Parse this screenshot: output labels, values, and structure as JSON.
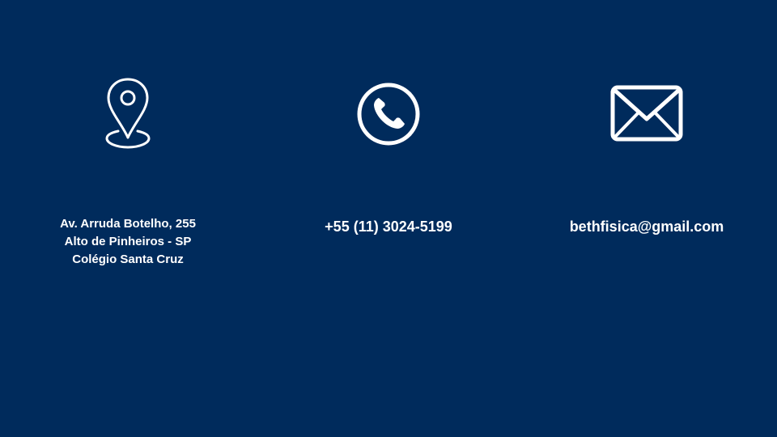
{
  "background_color": "#002b5c",
  "text_color": "#ffffff",
  "contacts": {
    "address": {
      "icon": "map-pin-icon",
      "lines": [
        "Av. Arruda Botelho, 255",
        "Alto de Pinheiros - SP",
        "Colégio Santa Cruz"
      ]
    },
    "phone": {
      "icon": "phone-icon",
      "text": "+55 (11) 3024-5199"
    },
    "email": {
      "icon": "envelope-icon",
      "text": "bethfisica@gmail.com"
    }
  }
}
